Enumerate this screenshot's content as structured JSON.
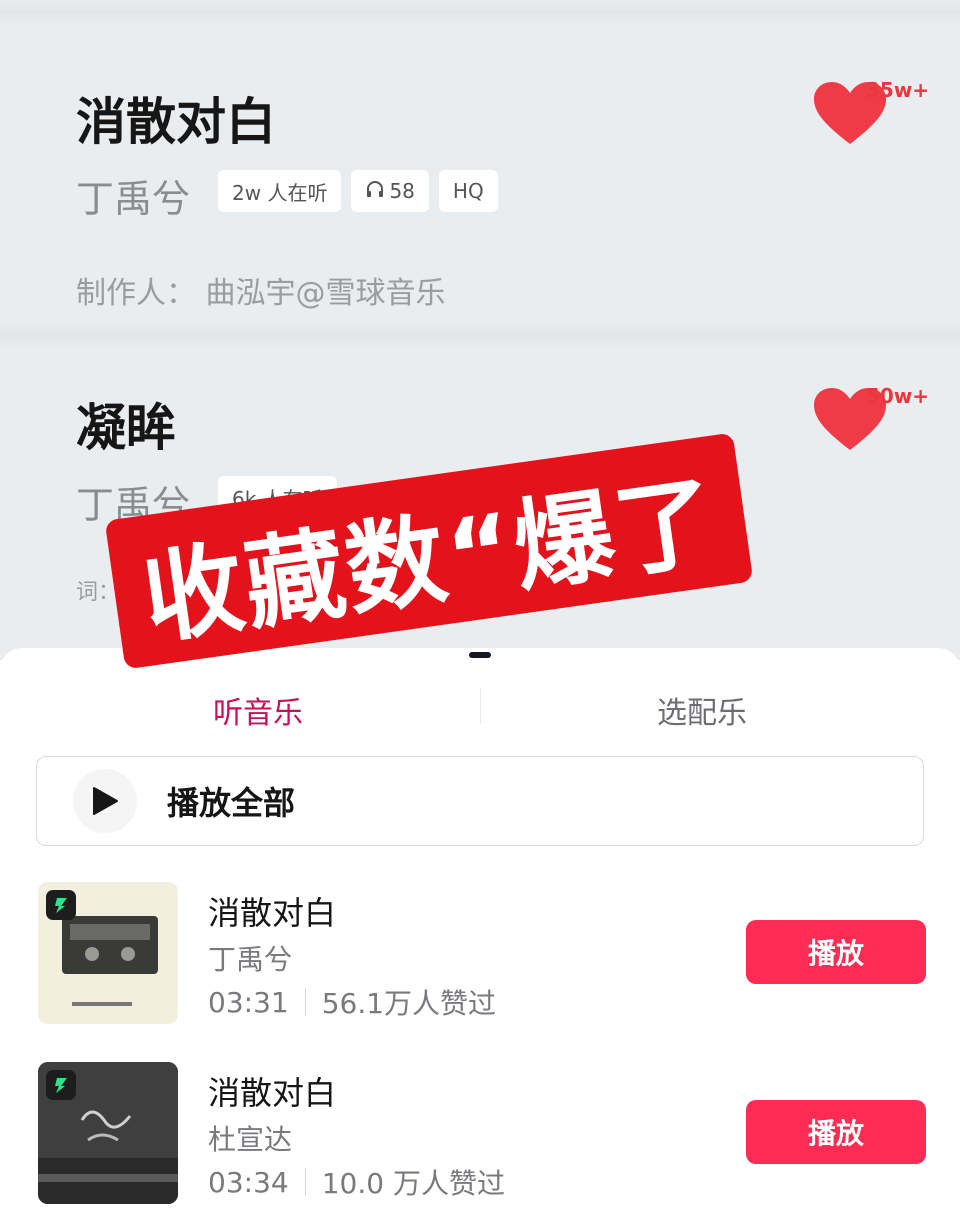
{
  "songs": [
    {
      "title": "消散对白",
      "artist": "丁禹兮",
      "listeners": "2w 人在听",
      "plays": "58",
      "quality": "HQ",
      "credit": "制作人：  曲泓宇@雪球音乐",
      "favorites": "35w+"
    },
    {
      "title": "凝眸",
      "artist": "丁禹兮",
      "listeners": "6k 人在听",
      "credit": "词：",
      "favorites": "50w+"
    }
  ],
  "overlay": {
    "text": "收藏数“爆了"
  },
  "panel": {
    "tabs": {
      "listen": "听音乐",
      "pick_bgm": "选配乐"
    },
    "play_all": "播放全部",
    "tracks": [
      {
        "name": "消散对白",
        "artist": "丁禹兮",
        "duration": "03:31",
        "likes": "56.1万人赞过",
        "play_label": "播放"
      },
      {
        "name": "消散对白",
        "artist": "杜宣达",
        "duration": "03:34",
        "likes": "10.0 万人赞过",
        "play_label": "播放"
      }
    ]
  },
  "colors": {
    "accent": "#fe2c55",
    "tab_active": "#c6105a",
    "heart": "#ee3b45",
    "stamp": "#e3121b"
  },
  "icons": [
    "headphones-icon",
    "heart-icon",
    "play-icon",
    "music-app-icon"
  ]
}
